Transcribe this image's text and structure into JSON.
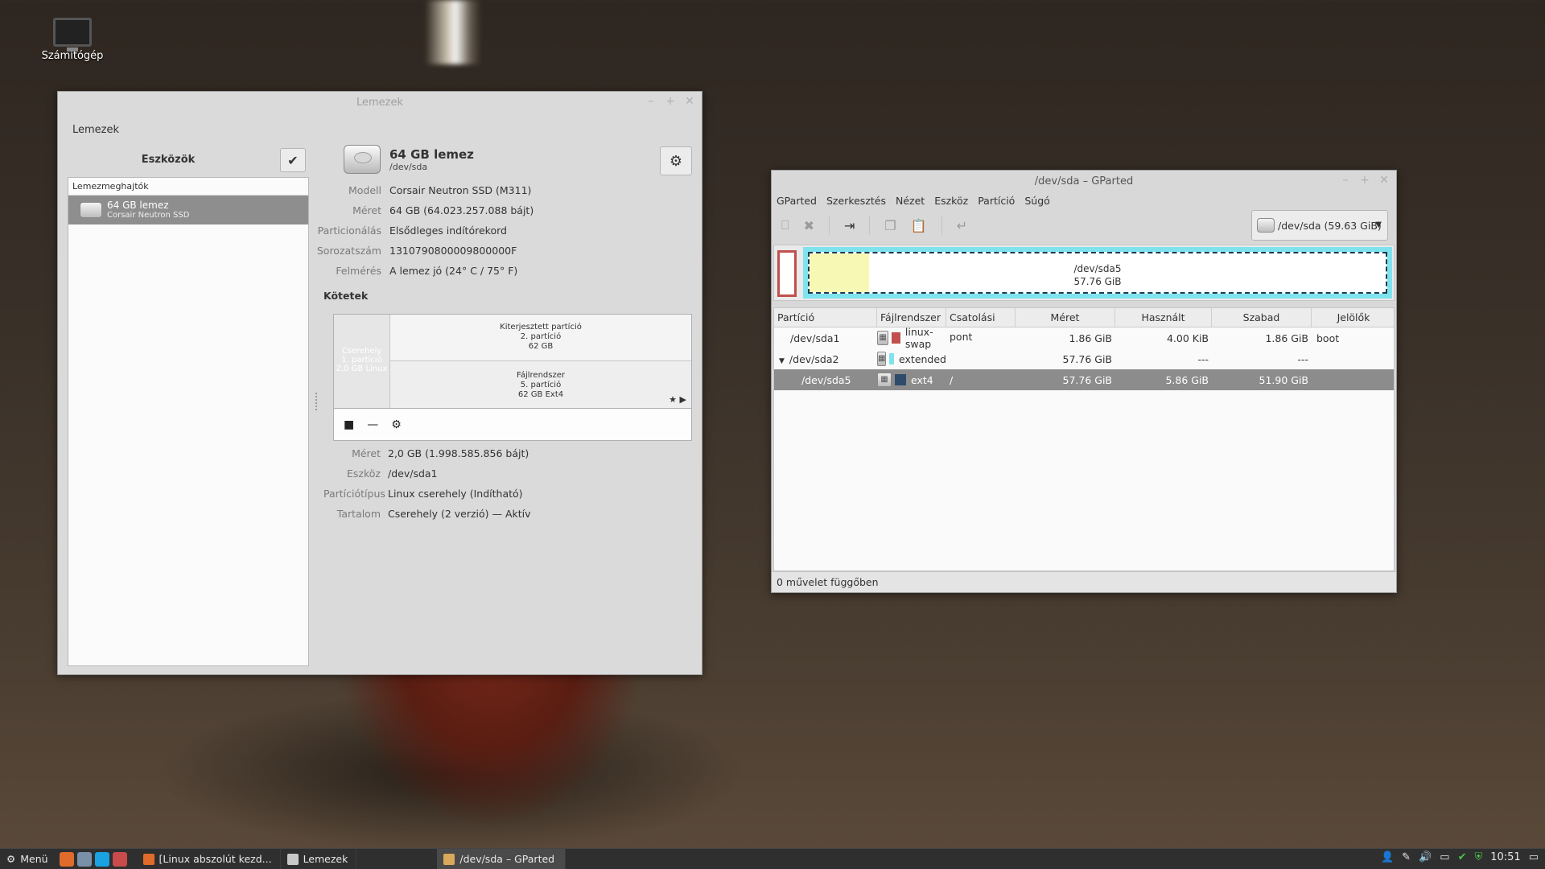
{
  "desktop": {
    "icon_label": "Számítógép"
  },
  "disks_window": {
    "title": "Lemezek",
    "toplabel": "Lemezek",
    "sidebar_title": "Eszközök",
    "section": "Lemezmeghajtók",
    "drive": {
      "name": "64 GB lemez",
      "model": "Corsair Neutron SSD"
    },
    "header_title": "64 GB lemez",
    "header_sub": "/dev/sda",
    "props": [
      {
        "k": "Modell",
        "v": "Corsair Neutron SSD (M311)"
      },
      {
        "k": "Méret",
        "v": "64 GB (64.023.257.088 bájt)"
      },
      {
        "k": "Particionálás",
        "v": "Elsődleges indítórekord"
      },
      {
        "k": "Sorozatszám",
        "v": "1310790800009800000F"
      },
      {
        "k": "Felmérés",
        "v": "A lemez jó (24° C / 75° F)"
      }
    ],
    "volumes_title": "Kötetek",
    "vol_top": {
      "l1": "Kiterjesztett partíció",
      "l2": "2. partíció",
      "l3": "62 GB"
    },
    "vol_bot": {
      "l1": "Fájlrendszer",
      "l2": "5. partíció",
      "l3": "62 GB Ext4"
    },
    "vol_left": {
      "l1": "Cserehely",
      "l2": "1. partíció",
      "l3": "2,0 GB Linux"
    },
    "part_props": [
      {
        "k": "Méret",
        "v": "2,0 GB (1.998.585.856 bájt)"
      },
      {
        "k": "Eszköz",
        "v": "/dev/sda1"
      },
      {
        "k": "Partíciótípus",
        "v": "Linux cserehely (Indítható)"
      },
      {
        "k": "Tartalom",
        "v": "Cserehely (2 verzió) — Aktív"
      }
    ]
  },
  "gparted_window": {
    "title": "/dev/sda – GParted",
    "menu": [
      "GParted",
      "Szerkesztés",
      "Nézet",
      "Eszköz",
      "Partíció",
      "Súgó"
    ],
    "device": "/dev/sda   (59.63 GiB)",
    "diskmap": {
      "name": "/dev/sda5",
      "size": "57.76 GiB"
    },
    "columns": [
      "Partíció",
      "Fájlrendszer",
      "Csatolási pont",
      "Méret",
      "Használt",
      "Szabad",
      "Jelölők"
    ],
    "rows": [
      {
        "part": "/dev/sda1",
        "fs": "linux-swap",
        "fs_color": "#c0504d",
        "mount": "",
        "size": "1.86 GiB",
        "used": "4.00 KiB",
        "free": "1.86 GiB",
        "flags": "boot"
      },
      {
        "part": "/dev/sda2",
        "fs": "extended",
        "fs_color": "#7fe3ee",
        "mount": "",
        "size": "57.76 GiB",
        "used": "---",
        "free": "---",
        "flags": ""
      },
      {
        "part": "/dev/sda5",
        "fs": "ext4",
        "fs_color": "#2e4b6b",
        "mount": "/",
        "size": "57.76 GiB",
        "used": "5.86 GiB",
        "free": "51.90 GiB",
        "flags": ""
      }
    ],
    "status": "0 művelet függőben"
  },
  "taskbar": {
    "menu_label": "Menü",
    "tasks": [
      "[Linux abszolút kezd...",
      "Lemezek",
      "/dev/sda – GParted"
    ],
    "clock": "10:51"
  }
}
